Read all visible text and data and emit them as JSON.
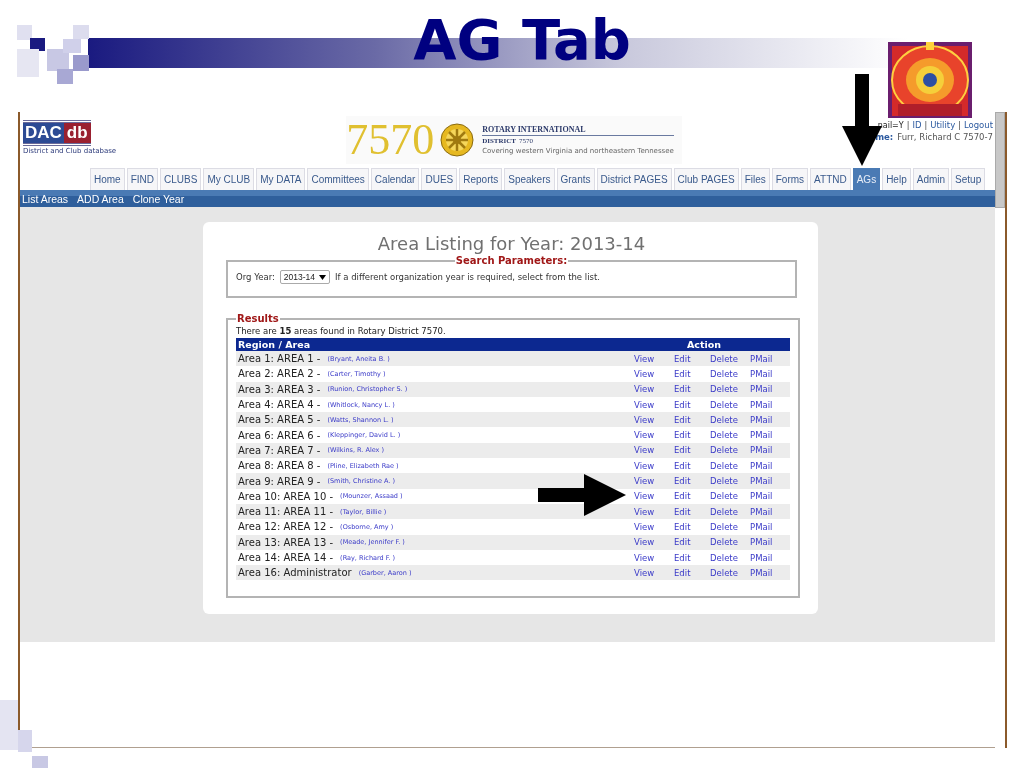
{
  "slide": {
    "title": "AG Tab"
  },
  "header": {
    "logo": {
      "left": "DAC",
      "right": "db",
      "subtitle": "District and Club database"
    },
    "district": {
      "number": "7570",
      "org": "ROTARY INTERNATIONAL",
      "district_label": "DISTRICT",
      "district_number": "7570",
      "tagline": "Covering western Virginia and northeastern Tennessee"
    },
    "user_links": [
      {
        "text": "nail=Y",
        "kind": "text"
      },
      {
        "text": "|",
        "kind": "sep"
      },
      {
        "text": "ID",
        "kind": "link"
      },
      {
        "text": "|",
        "kind": "sep"
      },
      {
        "text": "Utility",
        "kind": "link"
      },
      {
        "text": "|",
        "kind": "sep"
      },
      {
        "text": "Logout",
        "kind": "link"
      }
    ],
    "user_name": {
      "label": "me:",
      "value": "Furr, Richard C 7570-7"
    }
  },
  "tabs": [
    {
      "label": "Home",
      "selected": false
    },
    {
      "label": "FIND",
      "selected": false
    },
    {
      "label": "CLUBS",
      "selected": false
    },
    {
      "label": "My CLUB",
      "selected": false
    },
    {
      "label": "My DATA",
      "selected": false
    },
    {
      "label": "Committees",
      "selected": false
    },
    {
      "label": "Calendar",
      "selected": false
    },
    {
      "label": "DUES",
      "selected": false
    },
    {
      "label": "Reports",
      "selected": false
    },
    {
      "label": "Speakers",
      "selected": false
    },
    {
      "label": "Grants",
      "selected": false
    },
    {
      "label": "District PAGES",
      "selected": false
    },
    {
      "label": "Club PAGES",
      "selected": false
    },
    {
      "label": "Files",
      "selected": false
    },
    {
      "label": "Forms",
      "selected": false
    },
    {
      "label": "ATTND",
      "selected": false
    },
    {
      "label": "AGs",
      "selected": true
    },
    {
      "label": "Help",
      "selected": false
    },
    {
      "label": "Admin",
      "selected": false
    },
    {
      "label": "Setup",
      "selected": false
    }
  ],
  "subnav": [
    "List Areas",
    "ADD Area",
    "Clone Year"
  ],
  "page_title": "Area Listing for Year: 2013-14",
  "search": {
    "legend": "Search Parameters:",
    "label": "Org Year:",
    "value": "2013-14",
    "hint": "If a different organization year is required, select from the list."
  },
  "results": {
    "legend": "Results",
    "summary": "There are **15** areas found in Rotary District 7570.",
    "columns": [
      "Region / Area",
      "Action"
    ],
    "rows": [
      {
        "area": "Area 1: AREA 1 -",
        "person": "(Bryant, Aneita B. )",
        "actions": [
          "View",
          "Edit",
          "Delete",
          "PMail"
        ]
      },
      {
        "area": "Area 2: AREA 2 -",
        "person": "(Carter, Timothy )",
        "actions": [
          "View",
          "Edit",
          "Delete",
          "PMail"
        ]
      },
      {
        "area": "Area 3: AREA 3 -",
        "person": "(Runion, Christopher S. )",
        "actions": [
          "View",
          "Edit",
          "Delete",
          "PMail"
        ]
      },
      {
        "area": "Area 4: AREA 4 -",
        "person": "(Whitlock, Nancy L. )",
        "actions": [
          "View",
          "Edit",
          "Delete",
          "PMail"
        ]
      },
      {
        "area": "Area 5: AREA 5 -",
        "person": "(Watts, Shannon L. )",
        "actions": [
          "View",
          "Edit",
          "Delete",
          "PMail"
        ]
      },
      {
        "area": "Area 6: AREA 6 -",
        "person": "(Kleppinger, David L. )",
        "actions": [
          "View",
          "Edit",
          "Delete",
          "PMail"
        ]
      },
      {
        "area": "Area 7: AREA 7 -",
        "person": "(Wilkins, R. Alex )",
        "actions": [
          "View",
          "Edit",
          "Delete",
          "PMail"
        ]
      },
      {
        "area": "Area 8: AREA 8 -",
        "person": "(Pline, Elizabeth Rae )",
        "actions": [
          "View",
          "Edit",
          "Delete",
          "PMail"
        ]
      },
      {
        "area": "Area 9: AREA 9 -",
        "person": "(Smith, Christine A. )",
        "actions": [
          "View",
          "Edit",
          "Delete",
          "PMail"
        ]
      },
      {
        "area": "Area 10: AREA 10 -",
        "person": "(Mounzer, Assaad )",
        "actions": [
          "View",
          "Edit",
          "Delete",
          "PMail"
        ]
      },
      {
        "area": "Area 11: AREA 11 -",
        "person": "(Taylor, Billie )",
        "actions": [
          "View",
          "Edit",
          "Delete",
          "PMail"
        ]
      },
      {
        "area": "Area 12: AREA 12 -",
        "person": "(Osborne, Amy )",
        "actions": [
          "View",
          "Edit",
          "Delete",
          "PMail"
        ]
      },
      {
        "area": "Area 13: AREA 13 -",
        "person": "(Meade, Jennifer F. )",
        "actions": [
          "View",
          "Edit",
          "Delete",
          "PMail"
        ]
      },
      {
        "area": "Area 14: AREA 14 -",
        "person": "(Ray, Richard F. )",
        "actions": [
          "View",
          "Edit",
          "Delete",
          "PMail"
        ]
      },
      {
        "area": "Area 16: Administrator",
        "person": "(Garber, Aaron )",
        "actions": [
          "View",
          "Edit",
          "Delete",
          "PMail"
        ]
      }
    ]
  }
}
